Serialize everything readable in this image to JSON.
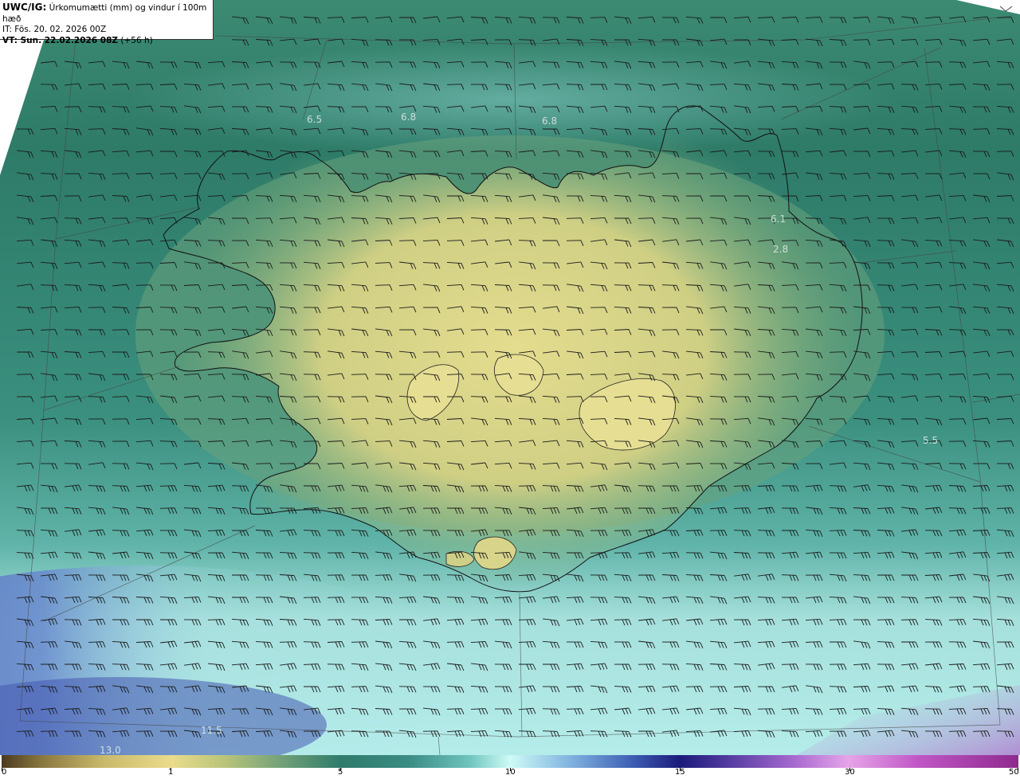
{
  "header": {
    "model": "UWC/IG:",
    "title": " Úrkomumætti (mm) og vindur í 100m hæð",
    "it_label": "IT: Fös. 20. 02. 2026 00Z",
    "vt_label": "VT: Sun. 22.02.2026 08Z",
    "vt_suffix": " (+56 h)"
  },
  "value_labels": [
    "6.5",
    "6.8",
    "6.8",
    "6.1",
    "2.8",
    "5.5",
    "11.5",
    "13.0"
  ],
  "colorbar": {
    "ticks": [
      "0",
      "1",
      "5",
      "10",
      "15",
      "30",
      "50"
    ]
  },
  "colors": {
    "lowland_green": "#2f7b6b",
    "ocean_teal": "#5fb0a6",
    "highland_yellow": "#e2da8c",
    "heavy_blue": "#4a5fb8",
    "coast_line": "#111111"
  }
}
